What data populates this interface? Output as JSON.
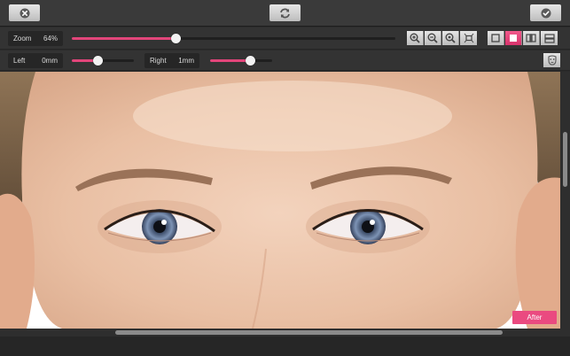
{
  "toolbar": {
    "cancel_icon": "close-circle-icon",
    "reset_icon": "refresh-icon",
    "confirm_icon": "checkmark-circle-icon"
  },
  "zoom": {
    "label": "Zoom",
    "value_text": "64%",
    "slider_fraction": 0.32
  },
  "zoom_buttons": [
    "zoom-in-icon",
    "zoom-out-icon",
    "zoom-actual-icon",
    "fit-screen-icon"
  ],
  "view_modes": [
    {
      "icon": "single-view-outline-icon",
      "active": false
    },
    {
      "icon": "single-view-filled-icon",
      "active": true
    },
    {
      "icon": "split-vertical-icon",
      "active": false
    },
    {
      "icon": "split-horizontal-icon",
      "active": false
    }
  ],
  "left": {
    "label": "Left",
    "value_text": "0mm",
    "slider_fraction": 0.41
  },
  "right": {
    "label": "Right",
    "value_text": "1mm",
    "slider_fraction": 0.64
  },
  "face_icon": "face-mask-icon",
  "viewer": {
    "badge": "After"
  },
  "colors": {
    "accent": "#e2457a",
    "panel": "#333333",
    "topbar": "#3a3a3a"
  }
}
